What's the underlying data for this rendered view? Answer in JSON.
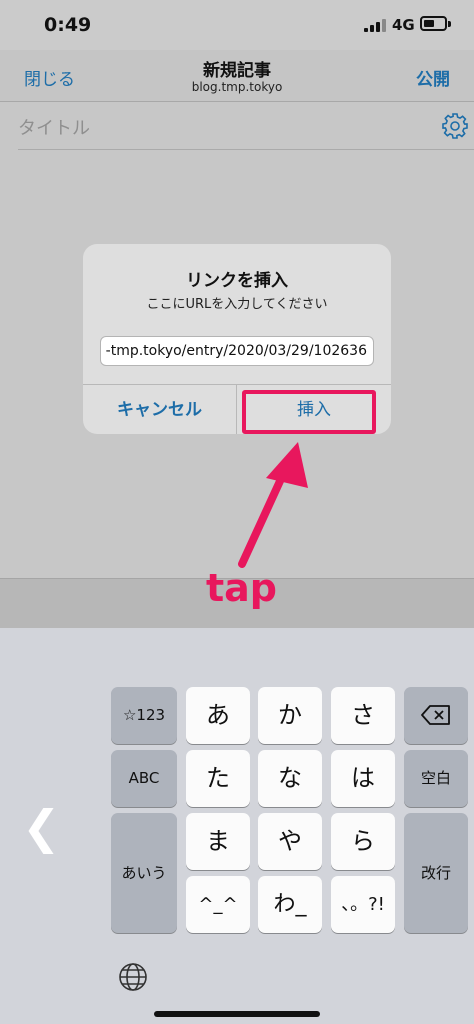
{
  "status_bar": {
    "time": "0:49",
    "network": "4G",
    "battery_level": 0.35
  },
  "nav": {
    "close_label": "閉じる",
    "title": "新規記事",
    "subtitle": "blog.tmp.tokyo",
    "publish_label": "公開"
  },
  "editor": {
    "title_placeholder": "タイトル",
    "settings_icon": "gear-icon"
  },
  "dialog": {
    "title": "リンクを挿入",
    "message": "ここにURLを入力してください",
    "input_value": "-tmp.tokyo/entry/2020/03/29/102636",
    "cancel_label": "キャンセル",
    "insert_label": "挿入"
  },
  "annotation": {
    "label": "tap",
    "color": "#e8175d"
  },
  "keyboard": {
    "keys": {
      "symbols": "☆123",
      "a": "あ",
      "ka": "か",
      "sa": "さ",
      "delete": "backspace-icon",
      "abc": "ABC",
      "ta": "た",
      "na": "な",
      "ha": "は",
      "space": "空白",
      "hiragana": "あいう",
      "ma": "ま",
      "ya": "や",
      "ra": "ら",
      "enter": "改行",
      "emoticon": "^_^",
      "wa": "わ_",
      "punct": "、。?!"
    },
    "left_chevron": "❮",
    "globe": "globe-icon"
  },
  "colors": {
    "accent": "#1d6da8",
    "highlight": "#e8175d"
  }
}
